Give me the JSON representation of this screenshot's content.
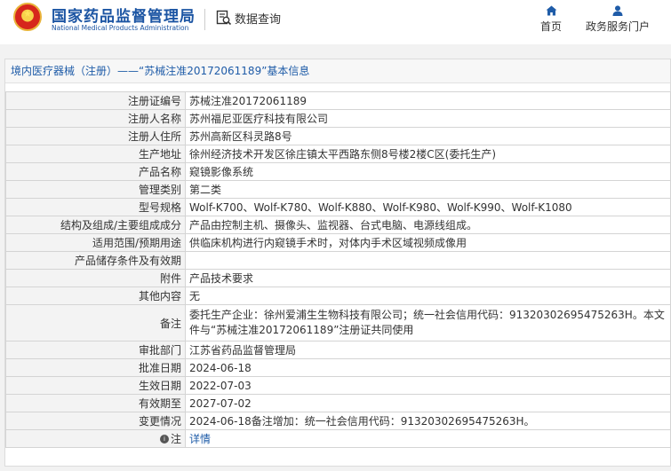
{
  "header": {
    "org_name_cn": "国家药品监督管理局",
    "org_name_en": "National Medical Products Administration",
    "query_label": "数据查询",
    "nav": {
      "home": "首页",
      "service": "政务服务门户"
    }
  },
  "panel": {
    "title": "境内医疗器械（注册）——“苏械注准20172061189”基本信息"
  },
  "rows": [
    {
      "label": "注册证编号",
      "value": "苏械注准20172061189"
    },
    {
      "label": "注册人名称",
      "value": "苏州福尼亚医疗科技有限公司"
    },
    {
      "label": "注册人住所",
      "value": "苏州高新区科灵路8号"
    },
    {
      "label": "生产地址",
      "value": "徐州经济技术开发区徐庄镇太平西路东侧8号楼2楼C区(委托生产)"
    },
    {
      "label": "产品名称",
      "value": "窥镜影像系统"
    },
    {
      "label": "管理类别",
      "value": "第二类"
    },
    {
      "label": "型号规格",
      "value": "Wolf-K700、Wolf-K780、Wolf-K880、Wolf-K980、Wolf-K990、Wolf-K1080"
    },
    {
      "label": "结构及组成/主要组成成分",
      "value": "产品由控制主机、摄像头、监视器、台式电脑、电源线组成。"
    },
    {
      "label": "适用范围/预期用途",
      "value": "供临床机构进行内窥镜手术时，对体内手术区域视频成像用"
    },
    {
      "label": "产品储存条件及有效期",
      "value": ""
    },
    {
      "label": "附件",
      "value": "产品技术要求"
    },
    {
      "label": "其他内容",
      "value": "无"
    },
    {
      "label": "备注",
      "value": "委托生产企业：徐州爱浦生生物科技有限公司；统一社会信用代码：91320302695475263H。本文件与“苏械注准20172061189”注册证共同使用"
    },
    {
      "label": "审批部门",
      "value": "江苏省药品监督管理局"
    },
    {
      "label": "批准日期",
      "value": "2024-06-18"
    },
    {
      "label": "生效日期",
      "value": "2022-07-03"
    },
    {
      "label": "有效期至",
      "value": "2027-07-02"
    },
    {
      "label": "变更情况",
      "value": "2024-06-18备注增加：统一社会信用代码：91320302695475263H。"
    }
  ],
  "note": {
    "label": "注",
    "link": "详情"
  },
  "colors": {
    "brand_blue": "#1c55a3",
    "link_blue": "#1f5ca8",
    "emblem_red": "#d6261c"
  },
  "icons": {
    "emblem": "national-emblem-icon",
    "query": "data-query-icon",
    "home": "home-icon",
    "service": "user-icon",
    "note": "info-icon"
  }
}
